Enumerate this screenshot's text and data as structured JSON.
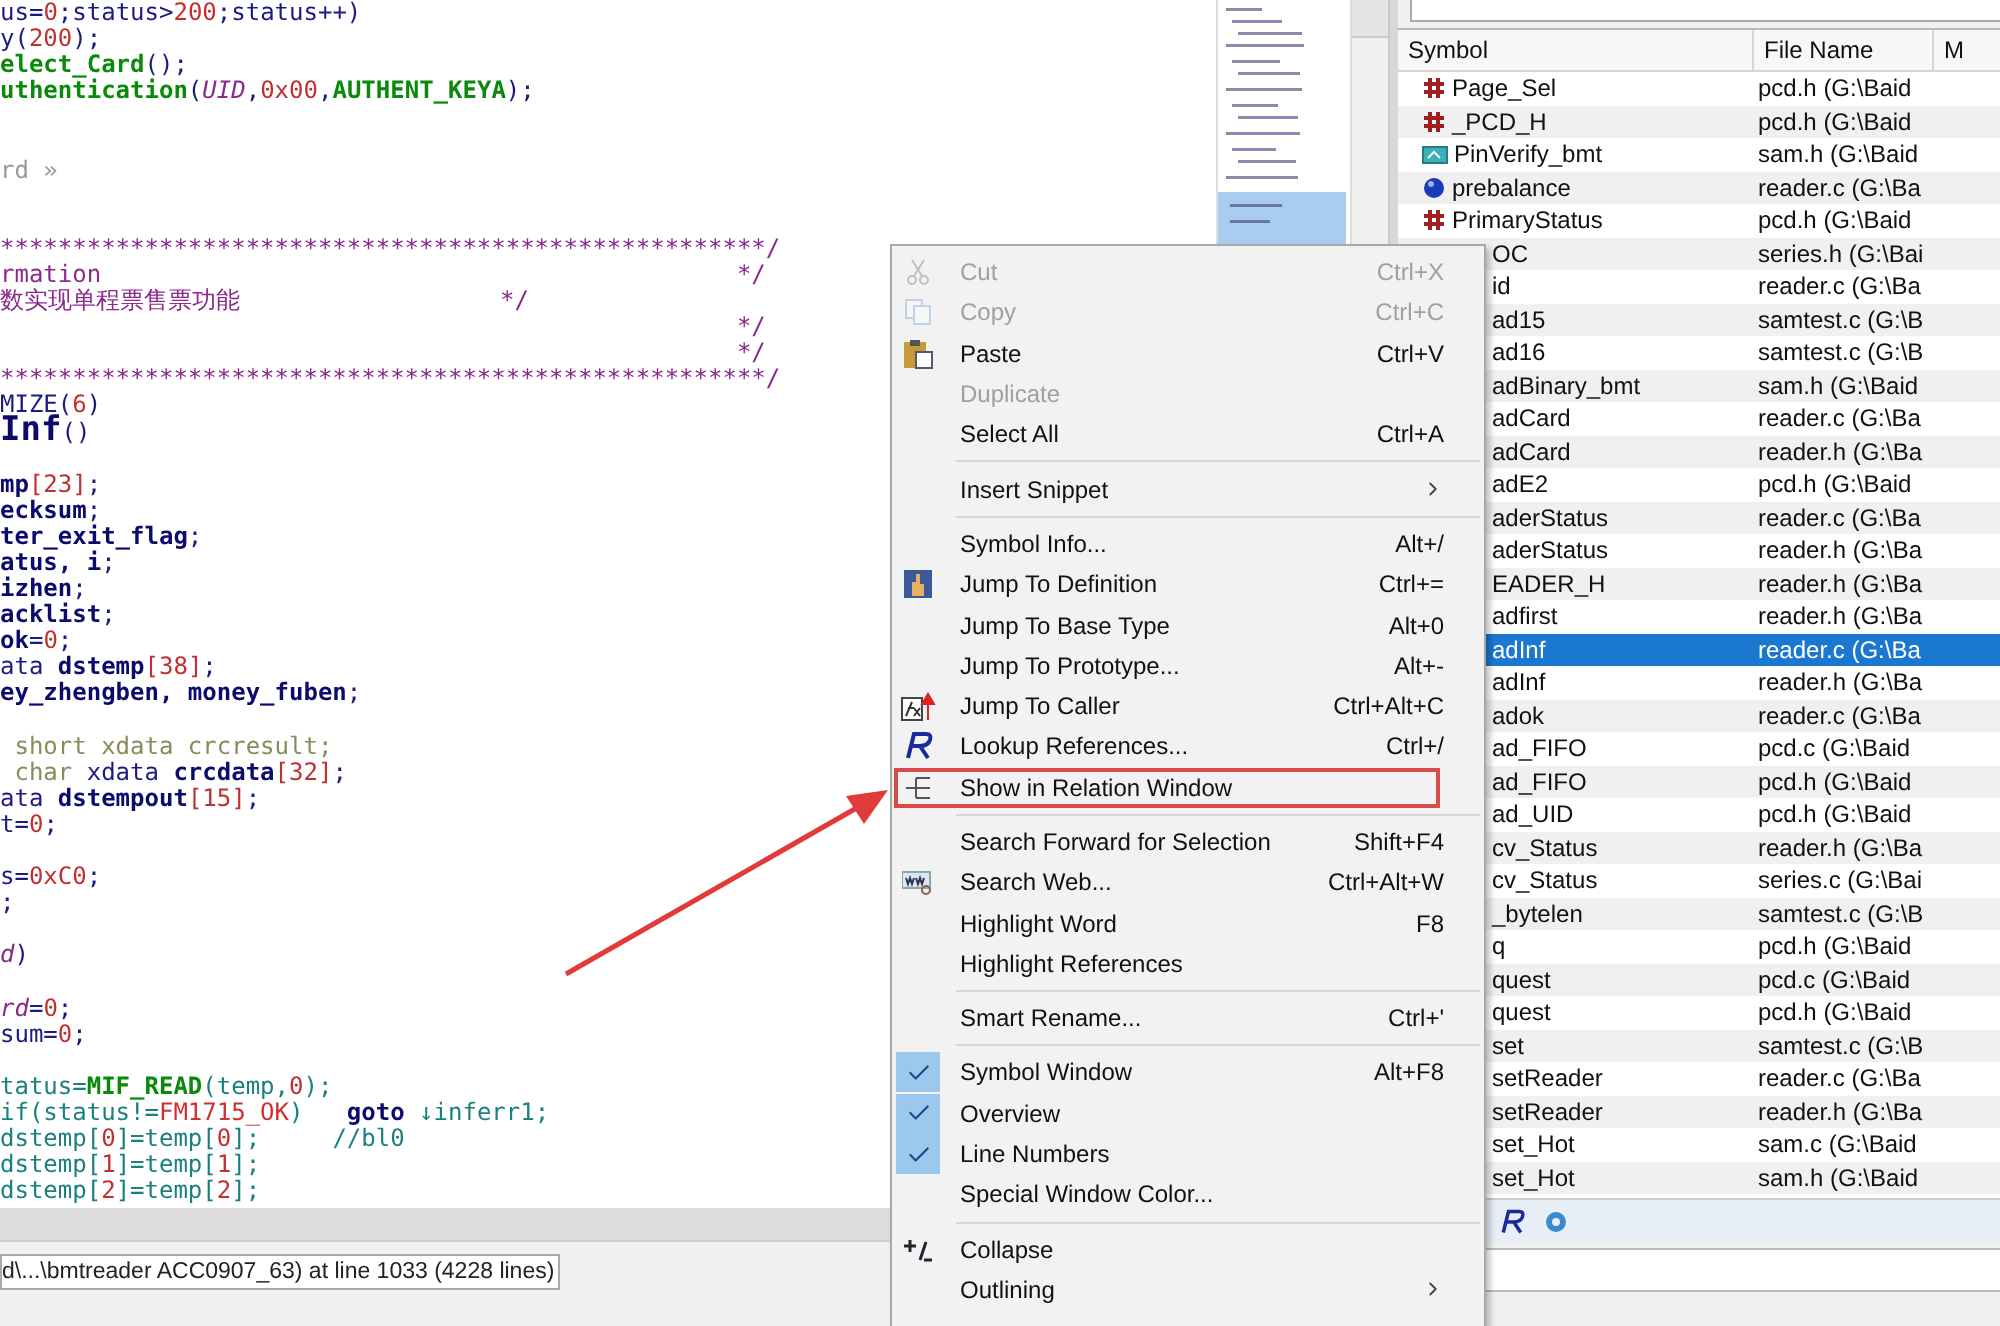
{
  "editor": {
    "lines": [
      {
        "kind": "code",
        "segments": [
          {
            "kind": "t",
            "text": "us="
          },
          {
            "kind": "n",
            "text": "0"
          },
          {
            "kind": "t",
            "text": ";status>"
          },
          {
            "kind": "n",
            "text": "200"
          },
          {
            "kind": "t",
            "text": ";status++)"
          }
        ]
      },
      {
        "kind": "code",
        "segments": [
          {
            "kind": "t",
            "text": "y("
          },
          {
            "kind": "n",
            "text": "200"
          },
          {
            "kind": "t",
            "text": ");"
          }
        ]
      },
      {
        "kind": "code",
        "segments": [
          {
            "kind": "f",
            "text": "elect_Card"
          },
          {
            "kind": "t",
            "text": "();"
          }
        ]
      },
      {
        "kind": "code",
        "segments": [
          {
            "kind": "f",
            "text": "uthentication"
          },
          {
            "kind": "t",
            "text": "("
          },
          {
            "kind": "i",
            "text": "UID"
          },
          {
            "kind": "t",
            "text": ","
          },
          {
            "kind": "n",
            "text": "0x00"
          },
          {
            "kind": "t",
            "text": ","
          },
          {
            "kind": "f",
            "text": "AUTHENT_KEYA"
          },
          {
            "kind": "t",
            "text": ");"
          }
        ]
      },
      {
        "kind": "blank"
      },
      {
        "kind": "blank"
      },
      {
        "kind": "code",
        "segments": [
          {
            "kind": "g",
            "text": "rd »"
          }
        ]
      },
      {
        "kind": "blank"
      },
      {
        "kind": "blank"
      },
      {
        "kind": "code",
        "segments": [
          {
            "kind": "c",
            "text": "*****************************************************/"
          }
        ]
      },
      {
        "kind": "code",
        "segments": [
          {
            "kind": "c",
            "text": "rmation                                            */"
          }
        ]
      },
      {
        "kind": "code",
        "segments": [
          {
            "kind": "c",
            "text": "数实现单程票售票功能                  */"
          }
        ]
      },
      {
        "kind": "code",
        "segments": [
          {
            "kind": "c",
            "text": "                                                   */"
          }
        ]
      },
      {
        "kind": "code",
        "segments": [
          {
            "kind": "c",
            "text": "                                                   */"
          }
        ]
      },
      {
        "kind": "code",
        "segments": [
          {
            "kind": "c",
            "text": "*****************************************************/"
          }
        ]
      },
      {
        "kind": "code",
        "segments": [
          {
            "kind": "t",
            "text": "MIZE("
          },
          {
            "kind": "n",
            "text": "6"
          },
          {
            "kind": "t",
            "text": ")"
          }
        ]
      },
      {
        "kind": "code",
        "segments": [
          {
            "kind": "h",
            "text": "Inf"
          },
          {
            "kind": "t",
            "text": "()"
          }
        ]
      },
      {
        "kind": "blank"
      },
      {
        "kind": "code",
        "segments": [
          {
            "kind": "b",
            "text": "mp"
          },
          {
            "kind": "n",
            "text": "[23]"
          },
          {
            "kind": "t",
            "text": ";"
          }
        ]
      },
      {
        "kind": "code",
        "segments": [
          {
            "kind": "b",
            "text": "ecksum"
          },
          {
            "kind": "t",
            "text": ";"
          }
        ]
      },
      {
        "kind": "code",
        "segments": [
          {
            "kind": "b",
            "text": "ter_exit_flag"
          },
          {
            "kind": "t",
            "text": ";"
          }
        ]
      },
      {
        "kind": "code",
        "segments": [
          {
            "kind": "b",
            "text": "atus, i"
          },
          {
            "kind": "t",
            "text": ";"
          }
        ]
      },
      {
        "kind": "code",
        "segments": [
          {
            "kind": "b",
            "text": "izhen"
          },
          {
            "kind": "t",
            "text": ";"
          }
        ]
      },
      {
        "kind": "code",
        "segments": [
          {
            "kind": "b",
            "text": "acklist"
          },
          {
            "kind": "t",
            "text": ";"
          }
        ]
      },
      {
        "kind": "code",
        "segments": [
          {
            "kind": "b",
            "text": "ok"
          },
          {
            "kind": "t",
            "text": "="
          },
          {
            "kind": "n",
            "text": "0"
          },
          {
            "kind": "t",
            "text": ";"
          }
        ]
      },
      {
        "kind": "code",
        "segments": [
          {
            "kind": "t",
            "text": "ata "
          },
          {
            "kind": "b",
            "text": "dstemp"
          },
          {
            "kind": "n",
            "text": "[38]"
          },
          {
            "kind": "t",
            "text": ";"
          }
        ]
      },
      {
        "kind": "code",
        "segments": [
          {
            "kind": "b",
            "text": "ey_zhengben, money_fuben"
          },
          {
            "kind": "t",
            "text": ";"
          }
        ]
      },
      {
        "kind": "blank"
      },
      {
        "kind": "code",
        "segments": [
          {
            "kind": "k",
            "text": " short xdata crcresult;"
          }
        ]
      },
      {
        "kind": "code",
        "segments": [
          {
            "kind": "k",
            "text": " char"
          },
          {
            "kind": "t",
            "text": " xdata "
          },
          {
            "kind": "b",
            "text": "crcdata"
          },
          {
            "kind": "n",
            "text": "[32]"
          },
          {
            "kind": "t",
            "text": ";"
          }
        ]
      },
      {
        "kind": "code",
        "segments": [
          {
            "kind": "t",
            "text": "ata "
          },
          {
            "kind": "b",
            "text": "dstempout"
          },
          {
            "kind": "n",
            "text": "[15]"
          },
          {
            "kind": "t",
            "text": ";"
          }
        ]
      },
      {
        "kind": "code",
        "segments": [
          {
            "kind": "t",
            "text": "t="
          },
          {
            "kind": "n",
            "text": "0"
          },
          {
            "kind": "t",
            "text": ";"
          }
        ]
      },
      {
        "kind": "blank"
      },
      {
        "kind": "code",
        "segments": [
          {
            "kind": "t",
            "text": "s="
          },
          {
            "kind": "n",
            "text": "0xC0"
          },
          {
            "kind": "t",
            "text": ";"
          }
        ]
      },
      {
        "kind": "code",
        "segments": [
          {
            "kind": "t",
            "text": ";"
          }
        ]
      },
      {
        "kind": "blank"
      },
      {
        "kind": "code",
        "segments": [
          {
            "kind": "i",
            "text": "d"
          },
          {
            "kind": "t",
            "text": ")"
          }
        ]
      },
      {
        "kind": "blank"
      },
      {
        "kind": "code",
        "segments": [
          {
            "kind": "i",
            "text": "rd"
          },
          {
            "kind": "t",
            "text": "="
          },
          {
            "kind": "n",
            "text": "0"
          },
          {
            "kind": "t",
            "text": ";"
          }
        ]
      },
      {
        "kind": "code",
        "segments": [
          {
            "kind": "t",
            "text": "sum="
          },
          {
            "kind": "n",
            "text": "0"
          },
          {
            "kind": "t",
            "text": ";"
          }
        ]
      },
      {
        "kind": "blank"
      },
      {
        "kind": "code",
        "segments": [
          {
            "kind": "v",
            "text": "tatus="
          },
          {
            "kind": "f",
            "text": "MIF_READ"
          },
          {
            "kind": "v",
            "text": "(temp,"
          },
          {
            "kind": "n",
            "text": "0"
          },
          {
            "kind": "v",
            "text": ");"
          }
        ]
      },
      {
        "kind": "code",
        "segments": [
          {
            "kind": "v",
            "text": "if(status!="
          },
          {
            "kind": "m",
            "text": "FM1715_OK"
          },
          {
            "kind": "v",
            "text": ")   "
          },
          {
            "kind": "b",
            "text": "goto"
          },
          {
            "kind": "v",
            "text": " ↓inferr1;"
          }
        ]
      },
      {
        "kind": "code",
        "segments": [
          {
            "kind": "v",
            "text": "dstemp["
          },
          {
            "kind": "n",
            "text": "0"
          },
          {
            "kind": "v",
            "text": "]=temp["
          },
          {
            "kind": "n",
            "text": "0"
          },
          {
            "kind": "v",
            "text": "];     //bl0"
          }
        ]
      },
      {
        "kind": "code",
        "segments": [
          {
            "kind": "v",
            "text": "dstemp["
          },
          {
            "kind": "n",
            "text": "1"
          },
          {
            "kind": "v",
            "text": "]=temp["
          },
          {
            "kind": "n",
            "text": "1"
          },
          {
            "kind": "v",
            "text": "];"
          }
        ]
      },
      {
        "kind": "code",
        "segments": [
          {
            "kind": "v",
            "text": "dstemp["
          },
          {
            "kind": "n",
            "text": "2"
          },
          {
            "kind": "v",
            "text": "]=temp["
          },
          {
            "kind": "n",
            "text": "2"
          },
          {
            "kind": "v",
            "text": "];"
          }
        ]
      }
    ]
  },
  "status_bar": "d\\...\\bmtreader ACC0907_63) at line 1033 (4228 lines)",
  "symbol_window": {
    "columns": [
      "Symbol",
      "File Name",
      "M"
    ],
    "rows": [
      {
        "kind": "hash",
        "symbol": "Page_Sel",
        "file": "pcd.h (G:\\Baid",
        "selected": false
      },
      {
        "kind": "hash",
        "symbol": "_PCD_H",
        "file": "pcd.h (G:\\Baid",
        "selected": false
      },
      {
        "kind": "func",
        "symbol": "PinVerify_bmt",
        "file": "sam.h (G:\\Baid",
        "selected": false
      },
      {
        "kind": "var",
        "symbol": "prebalance",
        "file": "reader.c (G:\\Ba",
        "selected": false
      },
      {
        "kind": "hash",
        "symbol": "PrimaryStatus",
        "file": "pcd.h (G:\\Baid",
        "selected": false
      },
      {
        "kind": "covered",
        "symbol": "OC",
        "file": "series.h (G:\\Bai",
        "selected": false
      },
      {
        "kind": "covered",
        "symbol": "id",
        "file": "reader.c (G:\\Ba",
        "selected": false
      },
      {
        "kind": "covered",
        "symbol": "ad15",
        "file": "samtest.c (G:\\B",
        "selected": false
      },
      {
        "kind": "covered",
        "symbol": "ad16",
        "file": "samtest.c (G:\\B",
        "selected": false
      },
      {
        "kind": "covered",
        "symbol": "adBinary_bmt",
        "file": "sam.h (G:\\Baid",
        "selected": false
      },
      {
        "kind": "covered",
        "symbol": "adCard",
        "file": "reader.c (G:\\Ba",
        "selected": false
      },
      {
        "kind": "covered",
        "symbol": "adCard",
        "file": "reader.h (G:\\Ba",
        "selected": false
      },
      {
        "kind": "covered",
        "symbol": "adE2",
        "file": "pcd.h (G:\\Baid",
        "selected": false
      },
      {
        "kind": "covered",
        "symbol": "aderStatus",
        "file": "reader.c (G:\\Ba",
        "selected": false
      },
      {
        "kind": "covered",
        "symbol": "aderStatus",
        "file": "reader.h (G:\\Ba",
        "selected": false
      },
      {
        "kind": "covered",
        "symbol": "EADER_H",
        "file": "reader.h (G:\\Ba",
        "selected": false
      },
      {
        "kind": "covered",
        "symbol": "adfirst",
        "file": "reader.h (G:\\Ba",
        "selected": false
      },
      {
        "kind": "covered",
        "symbol": "adInf",
        "file": "reader.c (G:\\Ba",
        "selected": true
      },
      {
        "kind": "covered",
        "symbol": "adInf",
        "file": "reader.h (G:\\Ba",
        "selected": false
      },
      {
        "kind": "covered",
        "symbol": "adok",
        "file": "reader.c (G:\\Ba",
        "selected": false
      },
      {
        "kind": "covered",
        "symbol": "ad_FIFO",
        "file": "pcd.c (G:\\Baid",
        "selected": false
      },
      {
        "kind": "covered",
        "symbol": "ad_FIFO",
        "file": "pcd.h (G:\\Baid",
        "selected": false
      },
      {
        "kind": "covered",
        "symbol": "ad_UID",
        "file": "pcd.h (G:\\Baid",
        "selected": false
      },
      {
        "kind": "covered",
        "symbol": "cv_Status",
        "file": "reader.h (G:\\Ba",
        "selected": false
      },
      {
        "kind": "covered",
        "symbol": "cv_Status",
        "file": "series.c (G:\\Bai",
        "selected": false
      },
      {
        "kind": "covered",
        "symbol": "_bytelen",
        "file": "samtest.c (G:\\B",
        "selected": false
      },
      {
        "kind": "covered",
        "symbol": "q",
        "file": "pcd.h (G:\\Baid",
        "selected": false
      },
      {
        "kind": "covered",
        "symbol": "quest",
        "file": "pcd.c (G:\\Baid",
        "selected": false
      },
      {
        "kind": "covered",
        "symbol": "quest",
        "file": "pcd.h (G:\\Baid",
        "selected": false
      },
      {
        "kind": "covered",
        "symbol": "set",
        "file": "samtest.c (G:\\B",
        "selected": false
      },
      {
        "kind": "covered",
        "symbol": "setReader",
        "file": "reader.c (G:\\Ba",
        "selected": false
      },
      {
        "kind": "covered",
        "symbol": "setReader",
        "file": "reader.h (G:\\Ba",
        "selected": false
      },
      {
        "kind": "covered",
        "symbol": "set_Hot",
        "file": "sam.c (G:\\Baid",
        "selected": false
      },
      {
        "kind": "covered",
        "symbol": "set_Hot",
        "file": "sam.h (G:\\Baid",
        "selected": false
      }
    ]
  },
  "context_menu": {
    "sections": [
      [
        {
          "kind": "cut",
          "label": "Cut",
          "shortcut": "Ctrl+X",
          "disabled": true,
          "checked": false,
          "submenu": false,
          "outlined": false
        },
        {
          "kind": "copy",
          "label": "Copy",
          "shortcut": "Ctrl+C",
          "disabled": true,
          "checked": false,
          "submenu": false,
          "outlined": false
        },
        {
          "kind": "paste",
          "label": "Paste",
          "shortcut": "Ctrl+V",
          "disabled": false,
          "checked": false,
          "submenu": false,
          "outlined": false
        },
        {
          "kind": "plain",
          "label": "Duplicate",
          "disabled": true,
          "checked": false,
          "submenu": false,
          "outlined": false
        },
        {
          "kind": "plain",
          "label": "Select All",
          "shortcut": "Ctrl+A",
          "disabled": false,
          "checked": false,
          "submenu": false,
          "outlined": false
        }
      ],
      [
        {
          "kind": "plain",
          "label": "Insert Snippet",
          "disabled": false,
          "checked": false,
          "submenu": true,
          "outlined": false
        }
      ],
      [
        {
          "kind": "plain",
          "label": "Symbol Info...",
          "shortcut": "Alt+/",
          "disabled": false,
          "checked": false,
          "submenu": false,
          "outlined": false
        },
        {
          "kind": "definition",
          "label": "Jump To Definition",
          "shortcut": "Ctrl+=",
          "disabled": false,
          "checked": false,
          "submenu": false,
          "outlined": false
        },
        {
          "kind": "plain",
          "label": "Jump To Base Type",
          "shortcut": "Alt+0",
          "disabled": false,
          "checked": false,
          "submenu": false,
          "outlined": false
        },
        {
          "kind": "plain",
          "label": "Jump To Prototype...",
          "shortcut": "Alt+-",
          "disabled": false,
          "checked": false,
          "submenu": false,
          "outlined": false
        },
        {
          "kind": "caller",
          "label": "Jump To Caller",
          "shortcut": "Ctrl+Alt+C",
          "disabled": false,
          "checked": false,
          "submenu": false,
          "outlined": false
        },
        {
          "kind": "references",
          "label": "Lookup References...",
          "shortcut": "Ctrl+/",
          "disabled": false,
          "checked": false,
          "submenu": false,
          "outlined": false
        },
        {
          "kind": "relation",
          "label": "Show in Relation Window",
          "disabled": false,
          "checked": false,
          "submenu": false,
          "outlined": true
        }
      ],
      [
        {
          "kind": "plain",
          "label": "Search Forward for Selection",
          "shortcut": "Shift+F4",
          "disabled": false,
          "checked": false,
          "submenu": false,
          "outlined": false
        },
        {
          "kind": "web",
          "label": "Search Web...",
          "shortcut": "Ctrl+Alt+W",
          "disabled": false,
          "checked": false,
          "submenu": false,
          "outlined": false
        },
        {
          "kind": "plain",
          "label": "Highlight Word",
          "shortcut": "F8",
          "disabled": false,
          "checked": false,
          "submenu": false,
          "outlined": false
        },
        {
          "kind": "plain",
          "label": "Highlight References",
          "disabled": false,
          "checked": false,
          "submenu": false,
          "outlined": false
        }
      ],
      [
        {
          "kind": "plain",
          "label": "Smart Rename...",
          "shortcut": "Ctrl+'",
          "disabled": false,
          "checked": false,
          "submenu": false,
          "outlined": false
        }
      ],
      [
        {
          "kind": "plain",
          "label": "Symbol Window",
          "shortcut": "Alt+F8",
          "disabled": false,
          "checked": true,
          "submenu": false,
          "outlined": false
        },
        {
          "kind": "plain",
          "label": "Overview",
          "disabled": false,
          "checked": true,
          "submenu": false,
          "outlined": false
        },
        {
          "kind": "plain",
          "label": "Line Numbers",
          "disabled": false,
          "checked": true,
          "submenu": false,
          "outlined": false
        },
        {
          "kind": "plain",
          "label": "Special Window Color...",
          "disabled": false,
          "checked": false,
          "submenu": false,
          "outlined": false
        }
      ],
      [
        {
          "kind": "collapse",
          "label": "Collapse",
          "disabled": false,
          "checked": false,
          "submenu": false,
          "outlined": false
        },
        {
          "kind": "plain",
          "label": "Outlining",
          "disabled": false,
          "checked": false,
          "submenu": true,
          "outlined": false
        }
      ]
    ]
  }
}
